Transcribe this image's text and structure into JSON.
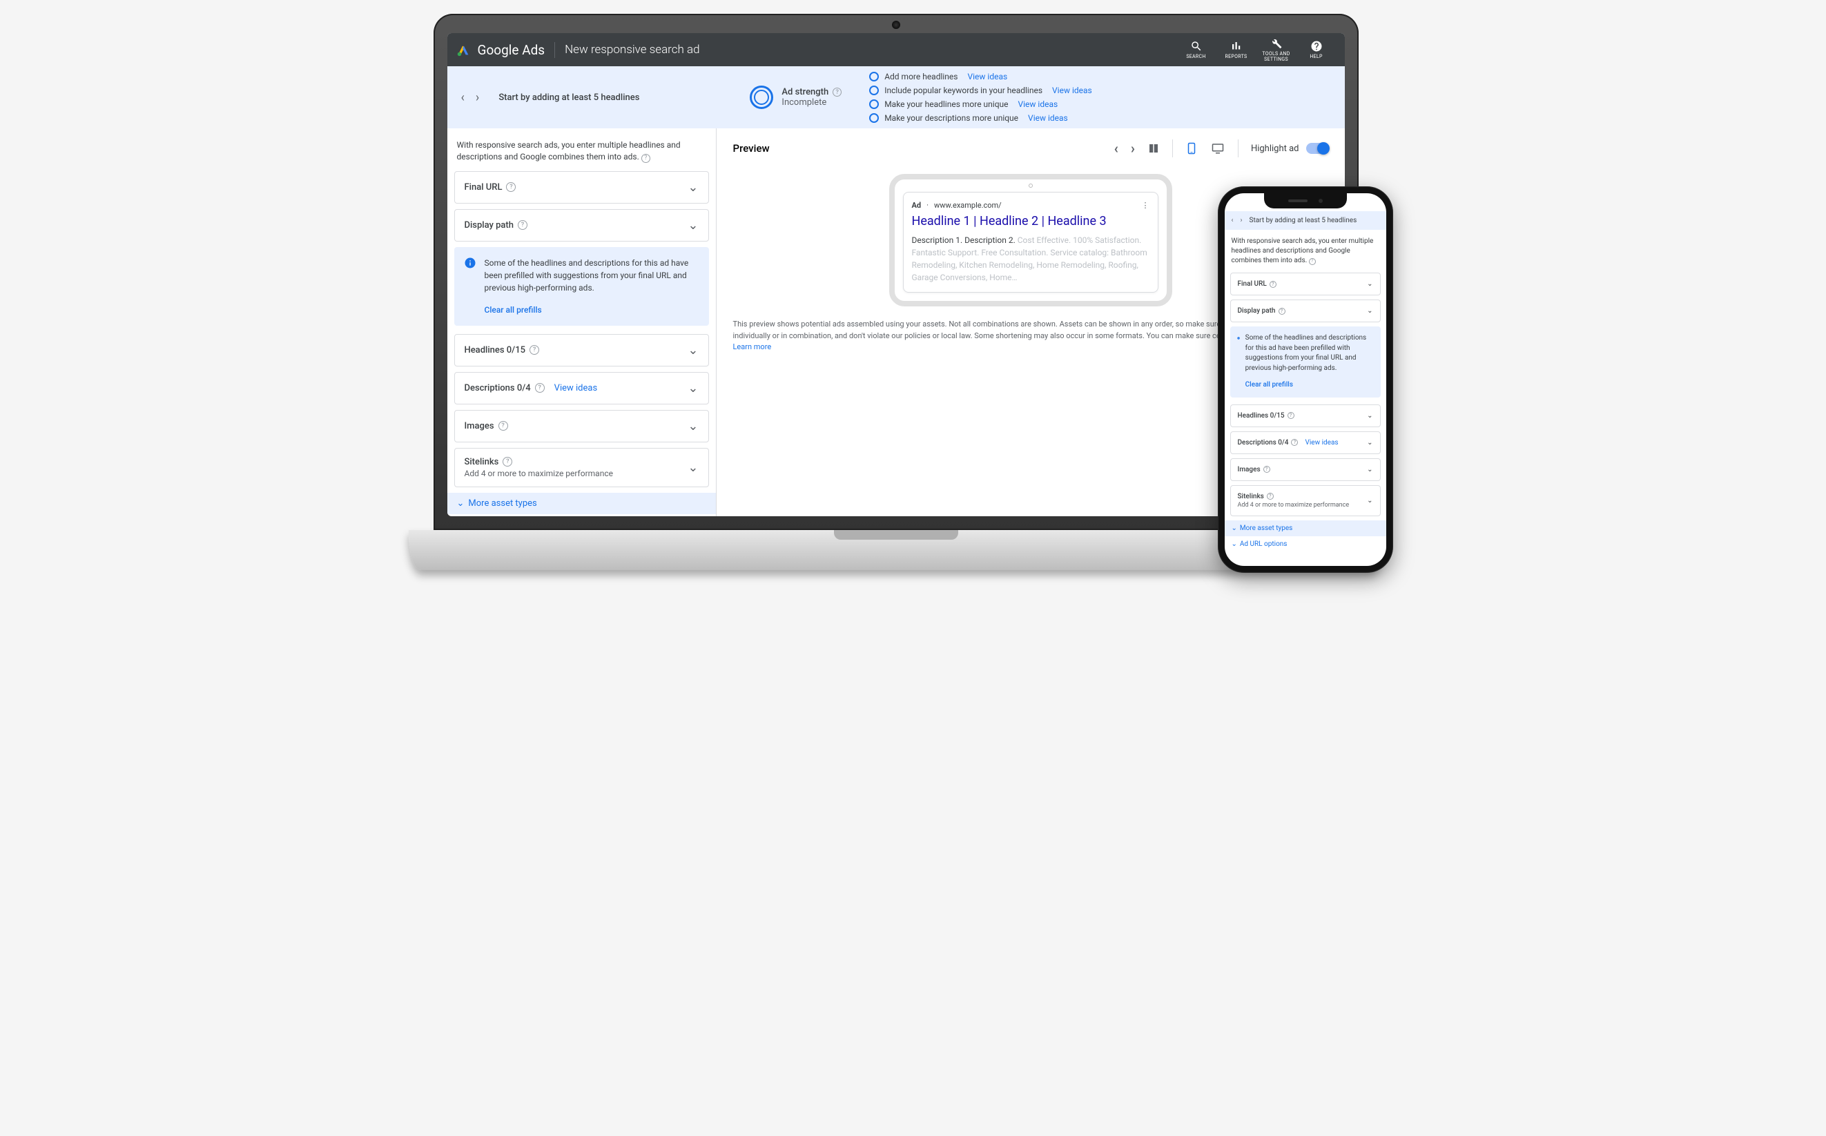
{
  "header": {
    "brand": "Google Ads",
    "title": "New responsive search ad",
    "tools": {
      "search": "SEARCH",
      "reports": "REPORTS",
      "tools": "TOOLS AND SETTINGS",
      "help": "HELP"
    }
  },
  "strengthBar": {
    "startText": "Start by adding at least 5 headlines",
    "label": "Ad strength",
    "status": "Incomplete",
    "suggestions": {
      "s1": "Add more headlines",
      "s2": "Include popular keywords in your headlines",
      "s3": "Make your headlines more unique",
      "s4": "Make your descriptions more unique"
    },
    "viewIdeas": "View ideas"
  },
  "left": {
    "intro": "With responsive search ads, you enter multiple headlines and descriptions and Google combines them into ads.",
    "finalUrl": "Final URL",
    "displayPath": "Display path",
    "infoBox": "Some of the headlines and descriptions for this ad have been prefilled with suggestions from your final URL and previous high-performing ads.",
    "clearPrefills": "Clear all prefills",
    "headlines": "Headlines 0/15",
    "descriptions": "Descriptions 0/4",
    "descViewIdeas": "View ideas",
    "images": "Images",
    "sitelinksTitle": "Sitelinks",
    "sitelinksSub": "Add 4 or more to maximize performance",
    "moreTypes": "More asset types",
    "adUrlOptions": "Ad URL options"
  },
  "preview": {
    "title": "Preview",
    "highlightLabel": "Highlight ad",
    "adLabel": "Ad",
    "url": "www.example.com/",
    "headline": "Headline 1 | Headline 2 | Headline 3",
    "descBold": "Description 1. Description 2.",
    "descFaded": "Cost Effective. 100% Satisfaction. Fantastic Support. Free Consultation. Service catalog: Bathroom Remodeling, Kitchen Remodeling, Home Remodeling, Roofing, Garage Conversions, Home…",
    "footer": "This preview shows potential ads assembled using your assets. Not all combinations are shown. Assets can be shown in any order, so make sure that they make sense individually or in combination, and don't violate our policies or local law. Some shortening may also occur in some formats. You can make sure certain text appears in your ad.",
    "learnMore": "Learn more"
  }
}
